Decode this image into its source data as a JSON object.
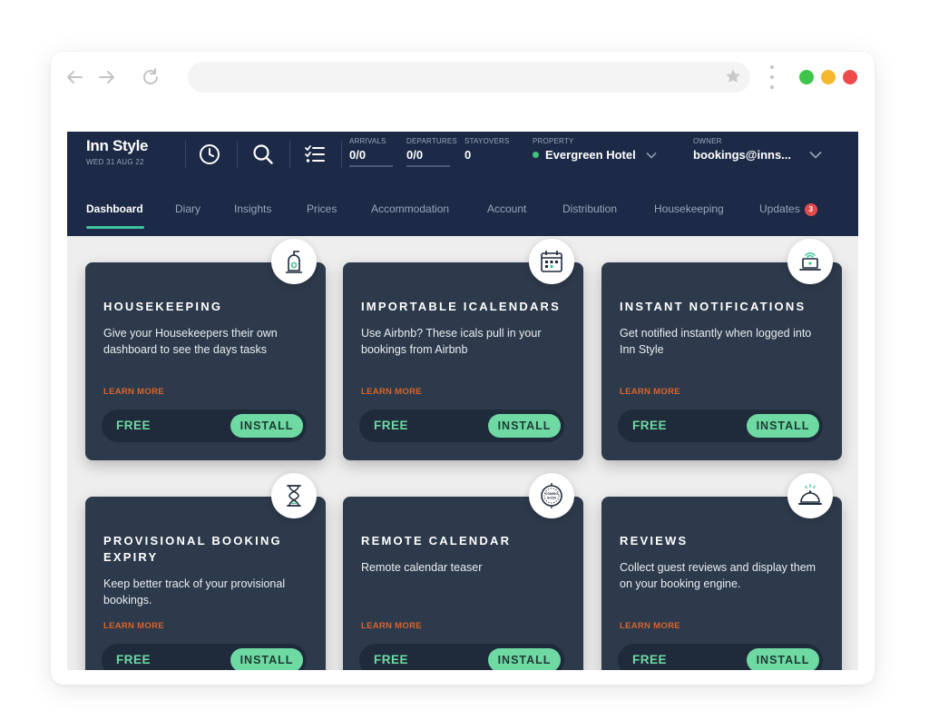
{
  "app": {
    "name": "Inn Style",
    "date": "WED 31 AUG 22"
  },
  "stats": {
    "arrivals": {
      "label": "ARRIVALS",
      "value": "0/0"
    },
    "departures": {
      "label": "DEPARTURES",
      "value": "0/0"
    },
    "stayovers": {
      "label": "STAYOVERS",
      "value": "0"
    }
  },
  "property": {
    "label": "PROPERTY",
    "value": "Evergreen Hotel"
  },
  "owner": {
    "label": "OWNER",
    "value": "bookings@inns..."
  },
  "tabs": [
    {
      "label": "Dashboard"
    },
    {
      "label": "Diary"
    },
    {
      "label": "Insights"
    },
    {
      "label": "Prices"
    },
    {
      "label": "Accommodation"
    },
    {
      "label": "Account"
    },
    {
      "label": "Distribution"
    },
    {
      "label": "Housekeeping"
    },
    {
      "label": "Updates",
      "badge": "3"
    }
  ],
  "cards": [
    {
      "title": "HOUSEKEEPING",
      "desc": "Give your Housekeepers their own dashboard to see the days tasks",
      "learn": "LEARN MORE",
      "price": "FREE",
      "install": "INSTALL",
      "icon": "vacuum-icon"
    },
    {
      "title": "IMPORTABLE ICALENDARS",
      "desc": "Use Airbnb? These icals pull in your bookings from Airbnb",
      "learn": "LEARN MORE",
      "price": "FREE",
      "install": "INSTALL",
      "icon": "calendar-icon"
    },
    {
      "title": "INSTANT NOTIFICATIONS",
      "desc": "Get notified instantly when logged into Inn Style",
      "learn": "LEARN MORE",
      "price": "FREE",
      "install": "INSTALL",
      "icon": "laptop-notification-icon"
    },
    {
      "title": "PROVISIONAL BOOKING EXPIRY",
      "desc": "Keep better track of your provisional bookings.",
      "learn": "LEARN MORE",
      "price": "FREE",
      "install": "INSTALL",
      "icon": "hourglass-icon"
    },
    {
      "title": "REMOTE CALENDAR",
      "desc": "Remote calendar teaser",
      "learn": "LEARN MORE",
      "price": "FREE",
      "install": "INSTALL",
      "icon": "coming-soon-icon",
      "icon_text": "COMING SOON"
    },
    {
      "title": "REVIEWS",
      "desc": "Collect guest reviews and display them on your booking engine.",
      "learn": "LEARN MORE",
      "price": "FREE",
      "install": "INSTALL",
      "icon": "service-bell-icon"
    }
  ],
  "colors": {
    "navy": "#1c2a47",
    "card": "#2d3a4b",
    "accent_green": "#6ed9a3",
    "learn_orange": "#d9642b",
    "badge_red": "#e14b4b"
  },
  "window_dots": [
    "#3ec44a",
    "#f5b82e",
    "#ef4b4b"
  ]
}
